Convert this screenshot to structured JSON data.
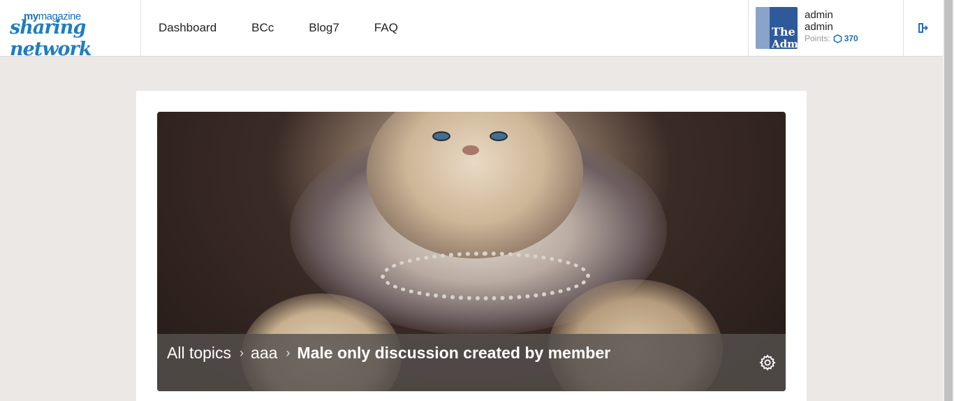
{
  "brand": {
    "small_prefix": "my",
    "small_rest": "magazine",
    "big": "sharing network",
    "color": "#1f7cc2"
  },
  "nav": {
    "items": [
      {
        "label": "Dashboard"
      },
      {
        "label": "BCc"
      },
      {
        "label": "Blog7"
      },
      {
        "label": "FAQ"
      }
    ]
  },
  "user": {
    "avatar_text_line1": "The",
    "avatar_text_line2": "Admi",
    "name": "admin",
    "username": "admin",
    "points_label": "Points:",
    "points_value": "370",
    "points_icon": "hexagon-icon"
  },
  "logout": {
    "icon": "logout-icon"
  },
  "topic": {
    "breadcrumb": [
      {
        "label": "All topics"
      },
      {
        "label": "aaa"
      }
    ],
    "title": "Male only discussion created by member",
    "settings_icon": "gear-icon"
  }
}
